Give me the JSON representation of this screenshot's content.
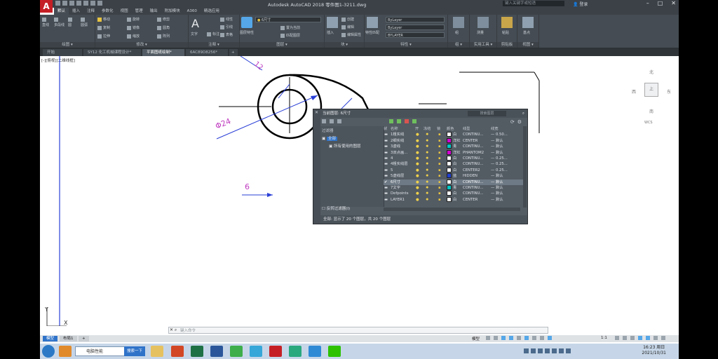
{
  "app": {
    "title": "Autodesk AutoCAD 2018    零件图1-3211.dwg",
    "search_placeholder": "键入关键字或短语",
    "login": "登录",
    "logo_letter": "A"
  },
  "menu_tabs": [
    "默认",
    "插入",
    "注释",
    "参数化",
    "视图",
    "管理",
    "输出",
    "附加模块",
    "A360",
    "精选应用"
  ],
  "ribbon": {
    "panels": [
      {
        "label": "绘图 ▾",
        "tools": [
          "直线",
          "多段线",
          "圆",
          "圆弧"
        ]
      },
      {
        "label": "修改 ▾",
        "tools": [
          "移动",
          "旋转",
          "修剪",
          "复制",
          "镜像",
          "圆角",
          "拉伸",
          "缩放",
          "阵列"
        ]
      },
      {
        "label": "注释 ▾",
        "tools": [
          "文字",
          "标注",
          "线性",
          "引线",
          "表格"
        ]
      },
      {
        "label": "图层 ▾",
        "tools": [
          "图层特性",
          "置为当前",
          "匹配图层"
        ],
        "combo": "6尺寸"
      },
      {
        "label": "块 ▾",
        "tools": [
          "插入",
          "创建",
          "编辑",
          "编辑属性"
        ]
      },
      {
        "label": "特性 ▾",
        "tools": [
          "特性匹配"
        ],
        "combos": [
          "ByLayer",
          "ByLayer",
          "BYLAYER"
        ]
      },
      {
        "label": "组 ▾",
        "tools": [
          "组"
        ]
      },
      {
        "label": "实用工具 ▾",
        "tools": [
          "测量"
        ]
      },
      {
        "label": "剪贴板",
        "tools": [
          "粘贴"
        ]
      },
      {
        "label": "视图 ▾",
        "tools": [
          "基点"
        ]
      }
    ]
  },
  "doc_tabs": [
    "开始",
    "SY12 化工机械课程设计*",
    "平面图纸绘制*",
    "6AC89D8256*"
  ],
  "view_label": "[-][俯视][二维线框]",
  "drawing": {
    "dim_24": "Φ24",
    "dim_6": "6",
    "dim_12": "12",
    "ucs_y": "Y",
    "ucs_x": "X"
  },
  "viewcube": {
    "north": "北",
    "south": "南",
    "west": "西",
    "east": "东",
    "top": "上",
    "wcs": "WCS"
  },
  "layer_palette": {
    "title": "当前图层: 6尺寸",
    "search": "搜索图层",
    "filters_label": "过滤器",
    "filter_all": "全部",
    "filter_used": "所有使用的图层",
    "invert": "反转过滤器(I)",
    "side_label": "图层特性管理器",
    "status": "全部: 显示了 20 个图层，共 20 个图层",
    "columns": [
      "状",
      "名称",
      "开",
      "冻结",
      "锁",
      "颜色",
      "线型",
      "线宽"
    ],
    "rows": [
      {
        "name": "1粗实线",
        "color": "白",
        "color_hex": "#ffffff",
        "linetype": "CONTINU...",
        "lineweight": "0.50..."
      },
      {
        "name": "2细实线",
        "color": "洋红",
        "color_hex": "#d400d4",
        "linetype": "CENTER",
        "lineweight": "默认"
      },
      {
        "name": "3虚线",
        "color": "青",
        "color_hex": "#00c8c8",
        "linetype": "CONTINU...",
        "lineweight": "默认"
      },
      {
        "name": "3双点画...",
        "color": "洋红",
        "color_hex": "#d400d4",
        "linetype": "PHANTOM2",
        "lineweight": "默认"
      },
      {
        "name": "4",
        "color": "白",
        "color_hex": "#ffffff",
        "linetype": "CONTINU...",
        "lineweight": "0.25..."
      },
      {
        "name": "4粗实线层",
        "color": "白",
        "color_hex": "#ffffff",
        "linetype": "CONTINU...",
        "lineweight": "0.25..."
      },
      {
        "name": "5",
        "color": "白",
        "color_hex": "#ffffff",
        "linetype": "CENTER2",
        "lineweight": "0.25..."
      },
      {
        "name": "5虚线层",
        "color": "蓝",
        "color_hex": "#1f3fd0",
        "linetype": "HIDDEN",
        "lineweight": "默认"
      },
      {
        "name": "6尺寸",
        "color": "白",
        "color_hex": "#ffffff",
        "linetype": "CONTINU...",
        "lineweight": "默认"
      },
      {
        "name": "7文字",
        "color": "青",
        "color_hex": "#00c8c8",
        "linetype": "CONTINU...",
        "lineweight": "默认"
      },
      {
        "name": "Defpoints",
        "color": "白",
        "color_hex": "#ffffff",
        "linetype": "CONTINU...",
        "lineweight": "默认"
      },
      {
        "name": "LAYER1",
        "color": "白",
        "color_hex": "#ffffff",
        "linetype": "CENTER",
        "lineweight": "默认"
      }
    ],
    "selected_index": 8
  },
  "command_line": {
    "placeholder": "键入命令"
  },
  "layout_tabs": [
    "模型",
    "布局1",
    "+"
  ],
  "status": {
    "model": "模型",
    "scale": "1:1"
  },
  "taskbar": {
    "search_text": "电脑性能",
    "search_button": "搜索一下",
    "time": "16:23 周日",
    "date": "2021/10/31"
  },
  "colors": {
    "accent": "#2f73c9",
    "autocad_red": "#c51f25",
    "ribbon": "#454c53",
    "dim_magenta": "#c03cc0"
  }
}
